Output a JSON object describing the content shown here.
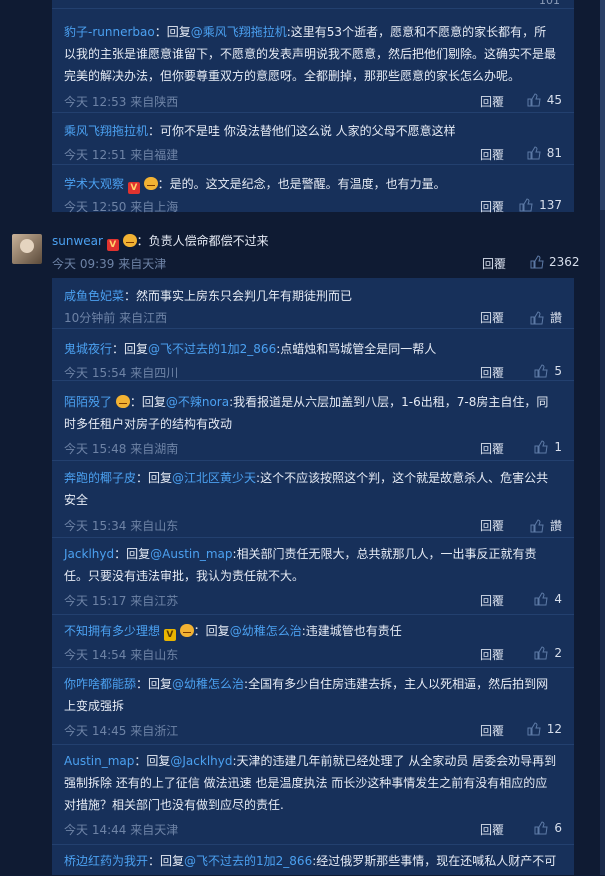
{
  "top_thread": {
    "stub_count": "101",
    "replies": [
      {
        "user": "豹子-runnerbao",
        "prefix": "：回复",
        "mention": "@乘风飞翔拖拉机",
        "text": ":这里有53个逝者，愿意和不愿意的家长都有，所以我的主张是谁愿意谁留下，不愿意的发表声明说我不愿意，然后把他们剔除。这确实不是最完美的解决办法，但你要尊重双方的意愿呀。全都删掉，那那些愿意的家长怎么办呢。",
        "meta": "今天 12:53 来自陕西",
        "reply_label": "回覆",
        "likes": "45"
      },
      {
        "user": "乘风飞翔拖拉机",
        "prefix": "：可你不是哇 你没法替他们这么说 人家的父母不愿意这样",
        "mention": "",
        "text": "",
        "meta": "今天 12:51 来自福建",
        "reply_label": "回覆",
        "likes": "81"
      },
      {
        "user": "学术大观察",
        "prefix": "：是的。这文是纪念，也是警醒。有温度，也有力量。",
        "mention": "",
        "text": "",
        "meta": "今天 12:50 来自上海",
        "reply_label": "回覆",
        "likes": "137"
      }
    ]
  },
  "main_comment": {
    "user": "sunwear",
    "text": "：负责人偿命都偿不过来",
    "meta": "今天 09:39 来自天津",
    "reply_label": "回覆",
    "likes": "2362"
  },
  "sub_replies": [
    {
      "user": "咸鱼色妃菜",
      "prefix": "：然而事实上房东只会判几年有期徒刑而已",
      "mention": "",
      "text": "",
      "meta": "10分钟前 来自江西",
      "reply_label": "回覆",
      "likes": "讚"
    },
    {
      "user": "鬼城夜行",
      "prefix": "：回复",
      "mention": "@飞不过去的1加2_866",
      "text": ":点蜡烛和骂城管全是同一帮人",
      "meta": "今天 15:54 来自四川",
      "reply_label": "回覆",
      "likes": "5"
    },
    {
      "user": "陌陌殁了",
      "prefix": "：回复",
      "mention": "@不辣nora",
      "text": ":我看报道是从六层加盖到八层，1-6出租，7-8房主自住，同时多任租户对房子的结构有改动",
      "meta": "今天 15:48 来自湖南",
      "reply_label": "回覆",
      "likes": "1"
    },
    {
      "user": "奔跑的椰子皮",
      "prefix": "：回复",
      "mention": "@江北区黄少天",
      "text": ":这个不应该按照这个判，这个就是故意杀人、危害公共安全",
      "meta": "今天 15:34 来自山东",
      "reply_label": "回覆",
      "likes": "讚"
    },
    {
      "user": "Jacklhyd",
      "prefix": "：回复",
      "mention": "@Austin_map",
      "text": ":相关部门责任无限大，总共就那几人，一出事反正就有责任。只要没有违法审批，我认为责任就不大。",
      "meta": "今天 15:17 来自江苏",
      "reply_label": "回覆",
      "likes": "4"
    },
    {
      "user": "不知拥有多少理想",
      "prefix": "：回复",
      "mention": "@幼稚怎么治",
      "text": ":违建城管也有责任",
      "meta": "今天 14:54 来自山东",
      "reply_label": "回覆",
      "likes": "2"
    },
    {
      "user": "你咋啥都能舔",
      "prefix": "：回复",
      "mention": "@幼稚怎么治",
      "text": ":全国有多少自住房违建去拆，主人以死相逼，然后拍到网上变成强拆",
      "meta": "今天 14:45 来自浙江",
      "reply_label": "回覆",
      "likes": "12"
    },
    {
      "user": "Austin_map",
      "prefix": "：回复",
      "mention": "@Jacklhyd",
      "text": ":天津的违建几年前就已经处理了 从全家动员 居委会劝导再到强制拆除 还有的上了征信 做法迅速 也是温度执法 而长沙这种事情发生之前有没有相应的应对措施？相关部门也没有做到应尽的责任.",
      "meta": "今天 14:44 来自天津",
      "reply_label": "回覆",
      "likes": "6"
    },
    {
      "user": "桥边红药为我开",
      "prefix": "：回复",
      "mention": "@飞不过去的1加2_866",
      "text": ":经过俄罗斯那些事情，现在还喊私人财产不可",
      "meta": "",
      "reply_label": "",
      "likes": ""
    }
  ],
  "colors": {
    "bg": "#0f1b33",
    "panel": "#17305a",
    "link": "#4ba0f0",
    "meta": "#6e83a6"
  }
}
